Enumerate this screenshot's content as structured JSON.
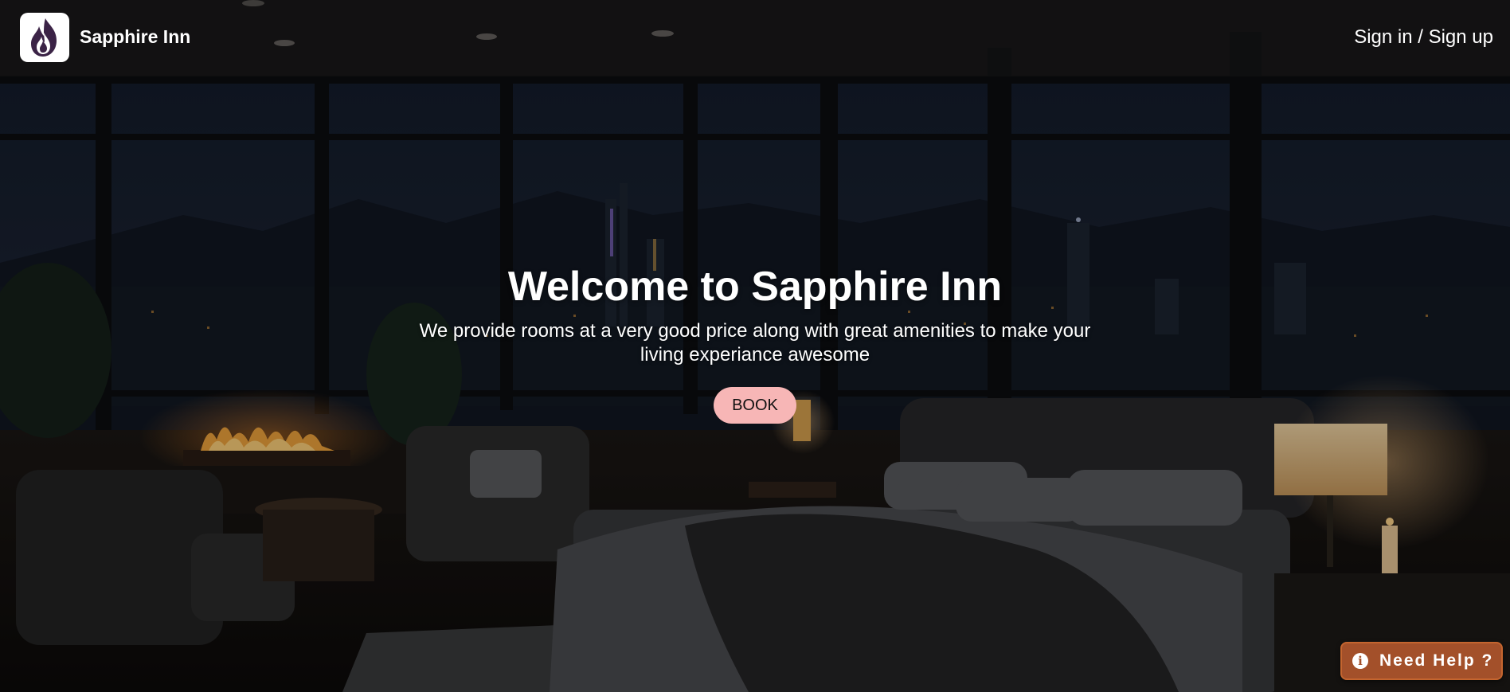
{
  "header": {
    "brand_name": "Sapphire Inn",
    "logo_icon": "flame-logo-icon",
    "auth_link": "Sign in / Sign up"
  },
  "hero": {
    "title": "Welcome to Sapphire Inn",
    "subtitle": "We provide rooms at a very good price along with great amenities to make your living experiance awesome",
    "book_label": "BOOK"
  },
  "help": {
    "icon": "info-icon",
    "icon_glyph": "i",
    "label": "Need Help ?"
  },
  "colors": {
    "book_button": "#f7b6b6",
    "help_button": "#a3502a",
    "logo_flame": "#3b2346"
  }
}
